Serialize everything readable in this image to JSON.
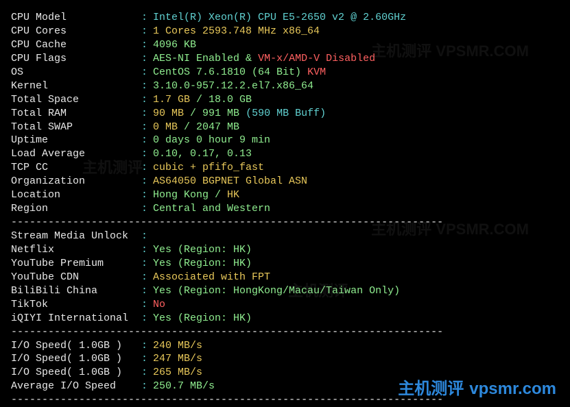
{
  "system": {
    "cpu_model": {
      "label": "CPU Model",
      "value": "Intel(R) Xeon(R) CPU E5-2650 v2 @ 2.60GHz"
    },
    "cpu_cores": {
      "label": "CPU Cores",
      "value": "1 Cores 2593.748 MHz x86_64"
    },
    "cpu_cache": {
      "label": "CPU Cache",
      "value": "4096 KB"
    },
    "cpu_flags": {
      "label": "CPU Flags",
      "v1": "AES-NI Enabled",
      "amp": " & ",
      "v2": "VM-x/AMD-V Disabled"
    },
    "os": {
      "label": "OS",
      "v1": "CentOS 7.6.1810 (64 Bit)",
      "v2": " KVM"
    },
    "kernel": {
      "label": "Kernel",
      "value": "3.10.0-957.12.2.el7.x86_64"
    },
    "total_space": {
      "label": "Total Space",
      "v1": "1.7 GB",
      "sep": " / ",
      "v2": "18.0 GB"
    },
    "total_ram": {
      "label": "Total RAM",
      "v1": "90 MB",
      "sep": " / ",
      "v2": "991 MB",
      "v3": " (590 MB Buff)"
    },
    "total_swap": {
      "label": "Total SWAP",
      "v1": "0 MB",
      "sep": " / ",
      "v2": "2047 MB"
    },
    "uptime": {
      "label": "Uptime",
      "value": "0 days 0 hour 9 min"
    },
    "load_avg": {
      "label": "Load Average",
      "value": "0.10, 0.17, 0.13"
    },
    "tcp_cc": {
      "label": "TCP CC",
      "value": "cubic + pfifo_fast"
    },
    "organization": {
      "label": "Organization",
      "value": "AS64050 BGPNET Global ASN"
    },
    "location": {
      "label": "Location",
      "v1": "Hong Kong",
      "sep": " / ",
      "v2": "HK"
    },
    "region": {
      "label": "Region",
      "value": "Central and Western"
    }
  },
  "stream": {
    "header": {
      "label": "Stream Media Unlock"
    },
    "netflix": {
      "label": "Netflix",
      "value": "Yes (Region: HK)"
    },
    "yt_premium": {
      "label": "YouTube Premium",
      "value": "Yes (Region: HK)"
    },
    "yt_cdn": {
      "label": "YouTube CDN",
      "value": "Associated with FPT"
    },
    "bilibili": {
      "label": "BiliBili China",
      "value": "Yes (Region: HongKong/Macau/Taiwan Only)"
    },
    "tiktok": {
      "label": "TikTok",
      "value": "No"
    },
    "iqiyi": {
      "label": "iQIYI International",
      "value": "Yes (Region: HK)"
    }
  },
  "io": {
    "s1": {
      "label": "I/O Speed( 1.0GB )",
      "value": "240 MB/s"
    },
    "s2": {
      "label": "I/O Speed( 1.0GB )",
      "value": "247 MB/s"
    },
    "s3": {
      "label": "I/O Speed( 1.0GB )",
      "value": "265 MB/s"
    },
    "avg": {
      "label": "Average I/O Speed",
      "value": "250.7 MB/s"
    }
  },
  "divider": "----------------------------------------------------------------------",
  "watermark": {
    "cn": "主机测评",
    "en": "vpsmr.com",
    "url": "VPSMR.COM"
  }
}
